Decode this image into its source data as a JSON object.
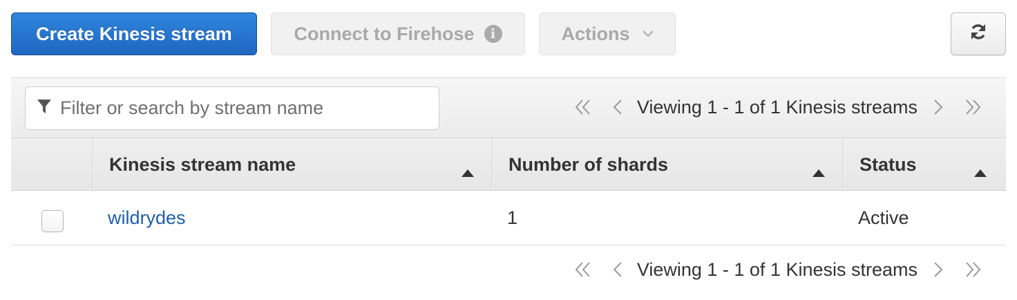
{
  "toolbar": {
    "create_label": "Create Kinesis stream",
    "firehose_label": "Connect to Firehose",
    "actions_label": "Actions"
  },
  "filter": {
    "placeholder": "Filter or search by stream name"
  },
  "pagination": {
    "text": "Viewing 1 - 1 of 1 Kinesis streams"
  },
  "table": {
    "columns": [
      "Kinesis stream name",
      "Number of shards",
      "Status"
    ],
    "rows": [
      {
        "name": "wildrydes",
        "shards": "1",
        "status": "Active"
      }
    ]
  },
  "colors": {
    "primary": "#1f66c1",
    "link": "#1f5fa7",
    "disabled_text": "#a9a9a9"
  }
}
